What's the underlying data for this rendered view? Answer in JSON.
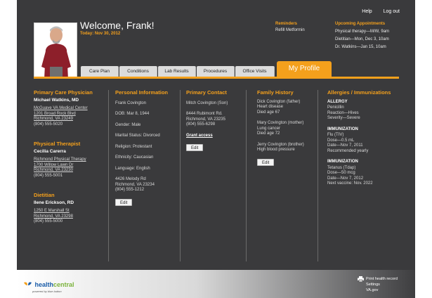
{
  "nav": {
    "help": "Help",
    "logout": "Log out"
  },
  "header": {
    "welcome": "Welcome, Frank!",
    "today": "Today: Nov 30, 2012"
  },
  "reminders": {
    "title": "Reminders",
    "item": "Refill Metformin"
  },
  "appointments": {
    "title": "Upcoming Appointments",
    "items": [
      "Physical therapy—M/W, 9am",
      "Dietitian—Mon, Dec 3, 10am",
      "Dr. Watkins—Jan 15, 10am"
    ]
  },
  "tabs": [
    "Care Plan",
    "Conditions",
    "Lab Results",
    "Procedures",
    "Office Visits"
  ],
  "active_tab": "My Profile",
  "care_team": {
    "pcp": {
      "title": "Primary Care Physician",
      "name": "Michael Watkins, MD",
      "org": "McGuave VA Medical Center",
      "addr1": "1201 Broad Rock Blvd",
      "addr2": "Richmond, VA 23249",
      "phone": "(804) 555-5020"
    },
    "pt": {
      "title": "Physical Therapist",
      "name": "Cecilia Carerra",
      "org": "Richmond Physical Therapy",
      "addr1": "1700 Willow Lawn Dr",
      "addr2": "Richmond, VA 23230",
      "phone": "(804) 555-5001"
    },
    "diet": {
      "title": "Dietitian",
      "name": "Ilene Erickson, RD",
      "addr1": "1250 E Marshall St",
      "addr2": "Richmond, VA 23298",
      "phone": "(804) 555-5000"
    }
  },
  "personal": {
    "title": "Personal Information",
    "name": "Frank Covington",
    "dob": "DOB: Mar 8, 1944",
    "gender": "Gender: Male",
    "marital": "Marital Status: Divorced",
    "religion": "Religion: Protestant",
    "ethnicity": "Ethnicity: Caucasian",
    "language": "Language: English",
    "addr1": "4426 Melody Rd",
    "addr2": "Richmond, VA 23234",
    "phone": "(804) 555-1212",
    "edit": "Edit"
  },
  "contact": {
    "title": "Primary Contact",
    "name": "Mitch Covington (Son)",
    "addr1": "8444 Rubimont Rd.",
    "addr2": "Richmond, VA 23235",
    "phone": "(804) 555-6298",
    "grant": "Grant access",
    "edit": "Edit"
  },
  "family": {
    "title": "Family History",
    "e1": {
      "who": "Dick Covington (father)",
      "cond": "Heart disease",
      "age": "Died age 67"
    },
    "e2": {
      "who": "Mary Covington (mother)",
      "cond": "Lung cancer",
      "age": "Died age 72"
    },
    "e3": {
      "who": "Jerry Covington (brother)",
      "cond": "High blood pressure"
    },
    "edit": "Edit"
  },
  "allergies": {
    "title": "Allergies / Immunizations",
    "allergy": {
      "h": "ALLERGY",
      "l1": "Penicillin",
      "l2": "Reaction—Hives",
      "l3": "Severity—Severe"
    },
    "imm1": {
      "h": "IMMUNIZATION",
      "l1": "Flu (TIV)",
      "l2": "Dose—0.5 mL",
      "l3": "Date—Nov 7, 2011",
      "l4": "Recommended yearly"
    },
    "imm2": {
      "h": "IMMUNIZATION",
      "l1": "Tetanus (Tdap)",
      "l2": "Dose—50 mcg",
      "l3": "Date—Nov 7, 2012",
      "l4": "Next vaccine: Nov. 2022"
    }
  },
  "footer": {
    "logo_a": "health",
    "logo_b": "central",
    "tagline": "powered by blue button",
    "print": "Print health record",
    "settings": "Settings",
    "va": "VA.gov"
  },
  "colors": {
    "accent": "#f4a01c",
    "background": "#3a3a3c"
  }
}
